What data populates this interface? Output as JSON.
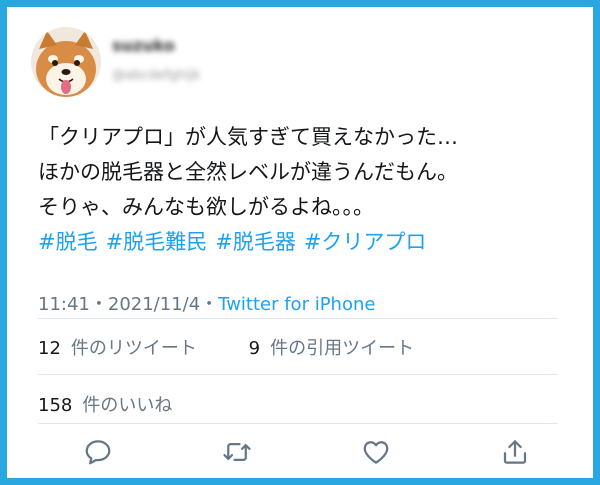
{
  "user": {
    "display_name": "suzuko",
    "handle": "@abcdefghijk"
  },
  "tweet": {
    "lines": [
      "「クリアプロ」が人気すぎて買えなかった…",
      "ほかの脱毛器と全然レベルが違うんだもん。",
      "そりゃ、みんなも欲しがるよね。。。"
    ],
    "hashtags": [
      "#脱毛",
      "#脱毛難民",
      "#脱毛器",
      "#クリアプロ"
    ]
  },
  "meta": {
    "time": "11:41",
    "date": "2021/11/4",
    "separator": "・",
    "source": "Twitter for iPhone"
  },
  "stats": {
    "retweets_count": "12",
    "retweets_label": "件のリツイート",
    "quotes_count": "9",
    "quotes_label": "件の引用ツイート",
    "likes_count": "158",
    "likes_label": "件のいいね"
  },
  "actions": {
    "reply": "reply-icon",
    "retweet": "retweet-icon",
    "like": "heart-icon",
    "share": "share-icon",
    "icon_color": "#657786"
  },
  "colors": {
    "border": "#29a7e1",
    "link": "#1da1f2"
  }
}
